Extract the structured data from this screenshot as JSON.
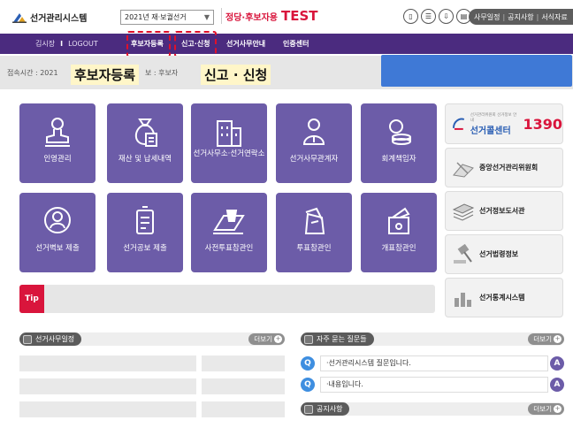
{
  "header": {
    "app_title": "선거관리시스템",
    "election_select": "2021년 재·보궐선거",
    "party_name": "정당·후보자용",
    "party_test": "TEST",
    "util_links": [
      "사무일정",
      "공지사항",
      "서식자료"
    ]
  },
  "nav": {
    "user": "김시장",
    "logout": "LOGOUT",
    "items": [
      "후보자등록",
      "신고·신청",
      "선거사무안내",
      "인증센터"
    ]
  },
  "info": {
    "login_time": "접속시간 : 2021",
    "name_prefix": "보 : 후보자"
  },
  "overlay_labels": {
    "left": "후보자등록",
    "right": "신고 · 신청"
  },
  "tiles": [
    {
      "label": "인영관리",
      "icon": "stamp-icon"
    },
    {
      "label": "재산 및 납세내역",
      "icon": "money-bag-icon"
    },
    {
      "label": "선거사무소·선거연락소",
      "icon": "building-icon"
    },
    {
      "label": "선거사무관계자",
      "icon": "person-icon"
    },
    {
      "label": "회계책임자",
      "icon": "coins-icon"
    },
    {
      "label": "선거벽보 제출",
      "icon": "poster-icon"
    },
    {
      "label": "선거공보 제출",
      "icon": "booklet-icon"
    },
    {
      "label": "사전투표참관인",
      "icon": "ballot-hand-icon"
    },
    {
      "label": "투표참관인",
      "icon": "ballot-box-icon"
    },
    {
      "label": "개표참관인",
      "icon": "counting-icon"
    }
  ],
  "right_panels": {
    "callcenter_small": "선거관리위원회 선거정보 안내",
    "callcenter_label": "선거콜센터",
    "callcenter_number": "1390",
    "items": [
      "중앙선거관리위원회",
      "선거정보도서관",
      "선거법령정보",
      "선거통계시스템"
    ]
  },
  "tip": {
    "label": "Tip"
  },
  "schedule": {
    "title": "선거사무일정",
    "more": "더보기"
  },
  "faq": {
    "title": "자주 묻는 질문들",
    "more": "더보기",
    "items": [
      "·선거관리시스템 질문입니다.",
      "·내용입니다."
    ]
  },
  "notice": {
    "title": "공지사항",
    "more": "더보기"
  },
  "colors": {
    "nav": "#4b2b7f",
    "tile": "#6c5ca8",
    "accent_red": "#d9153c",
    "blue_box": "#3f79d6"
  }
}
